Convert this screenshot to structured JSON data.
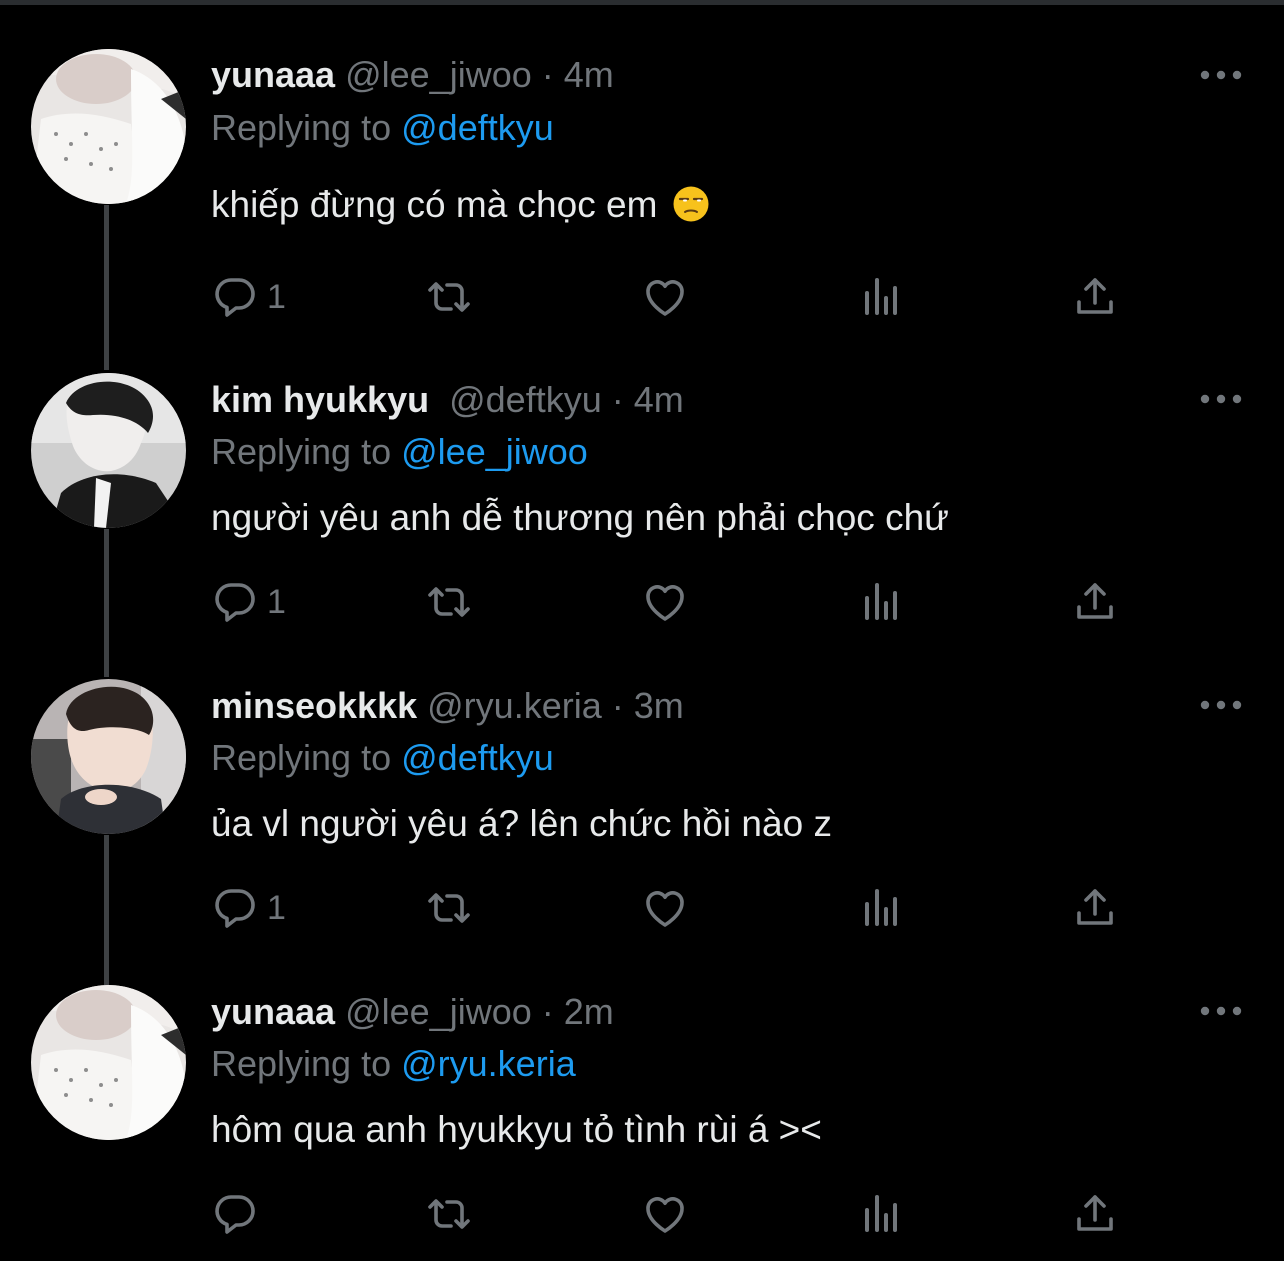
{
  "tweets": [
    {
      "name": "yunaaa",
      "handle": "@lee_jiwoo",
      "dot": "·",
      "time": "4m",
      "replying_label": "Replying to",
      "replying_to": "@deftkyu",
      "text": "khiếp đừng có mà chọc em",
      "emoji": "unamused-face",
      "reply_count": "1"
    },
    {
      "name": "kim hyukkyu",
      "handle": "@deftkyu",
      "dot": "·",
      "time": "4m",
      "replying_label": "Replying to",
      "replying_to": "@lee_jiwoo",
      "text": "người yêu anh dễ thương nên phải chọc chứ",
      "reply_count": "1"
    },
    {
      "name": "minseokkkk",
      "handle": "@ryu.keria",
      "dot": "·",
      "time": "3m",
      "replying_label": "Replying to",
      "replying_to": "@deftkyu",
      "text": "ủa vl người yêu á? lên chức hồi nào z",
      "reply_count": "1"
    },
    {
      "name": "yunaaa",
      "handle": "@lee_jiwoo",
      "dot": "·",
      "time": "2m",
      "replying_label": "Replying to",
      "replying_to": "@ryu.keria",
      "text": "hôm qua anh hyukkyu tỏ tình rùi á ><",
      "reply_count": ""
    }
  ],
  "icons": [
    "reply-icon",
    "retweet-icon",
    "like-icon",
    "analytics-icon",
    "share-icon",
    "more-icon"
  ],
  "colors": {
    "background": "#000000",
    "text": "#e7e9ea",
    "muted": "#71767b",
    "mention": "#1d9bf0",
    "thread_line": "#3e4144"
  }
}
